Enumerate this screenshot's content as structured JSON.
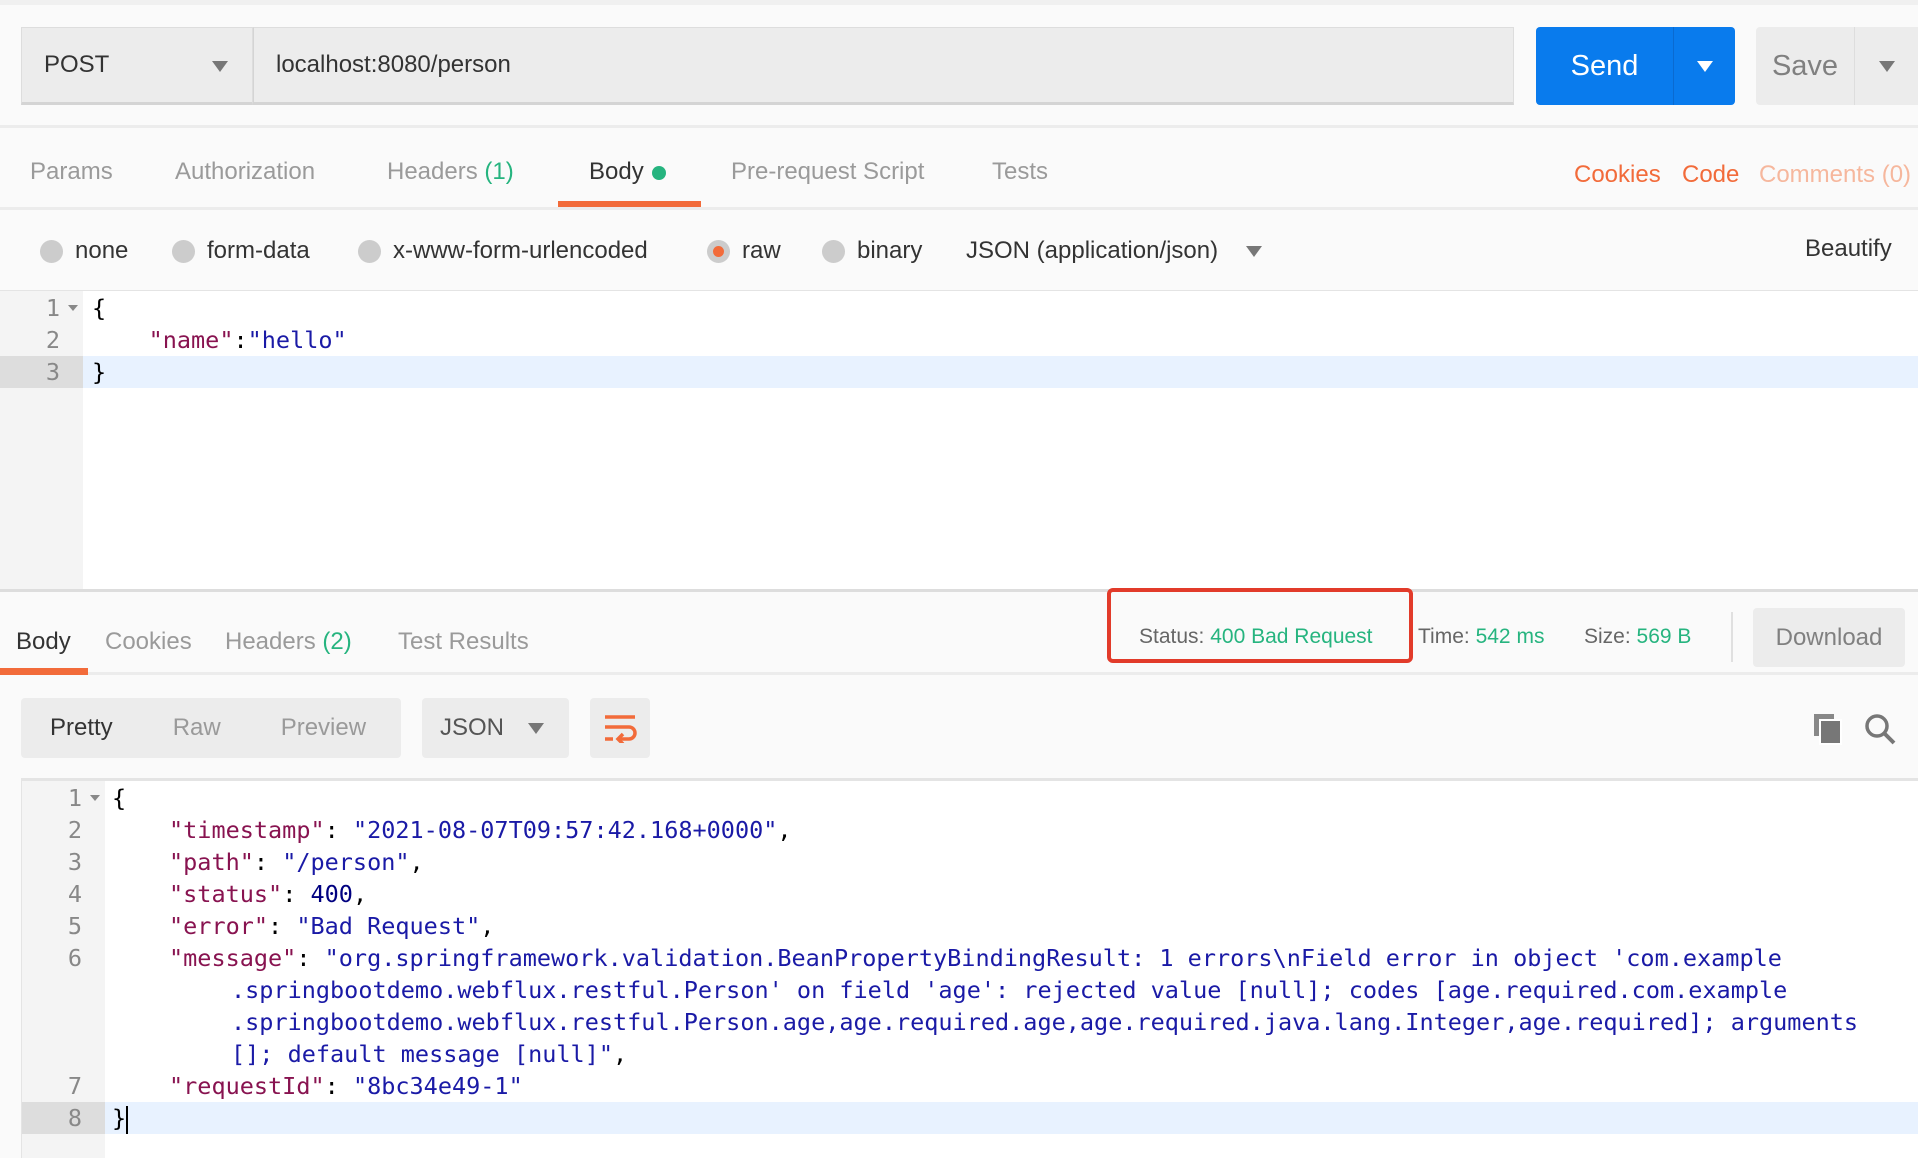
{
  "request": {
    "method": "POST",
    "url": "localhost:8080/person",
    "send_label": "Send",
    "save_label": "Save"
  },
  "tabs": [
    {
      "label": "Params"
    },
    {
      "label": "Authorization"
    },
    {
      "label": "Headers",
      "count": "(1)"
    },
    {
      "label": "Body"
    },
    {
      "label": "Pre-request Script"
    },
    {
      "label": "Tests"
    }
  ],
  "right_links": {
    "cookies": "Cookies",
    "code": "Code",
    "comments": "Comments (0)"
  },
  "body_types": [
    "none",
    "form-data",
    "x-www-form-urlencoded",
    "raw",
    "binary"
  ],
  "selected_body_type": "raw",
  "content_type": "JSON (application/json)",
  "beautify": "Beautify",
  "request_body": {
    "line_numbers": [
      "1",
      "2",
      "3"
    ],
    "lines": [
      "{",
      "    \"name\":\"hello\"",
      "}"
    ]
  },
  "response": {
    "tabs": [
      {
        "label": "Body"
      },
      {
        "label": "Cookies"
      },
      {
        "label": "Headers",
        "count": "(2)"
      },
      {
        "label": "Test Results"
      }
    ],
    "status_label": "Status:",
    "status": "400 Bad Request",
    "time_label": "Time:",
    "time": "542 ms",
    "size_label": "Size:",
    "size": "569 B",
    "download": "Download",
    "views": [
      "Pretty",
      "Raw",
      "Preview"
    ],
    "format": "JSON",
    "line_numbers": [
      "1",
      "2",
      "3",
      "4",
      "5",
      "6",
      "7",
      "8"
    ],
    "json": {
      "timestamp_key": "\"timestamp\"",
      "timestamp": "\"2021-08-07T09:57:42.168+0000\"",
      "path_key": "\"path\"",
      "path": "\"/person\"",
      "status_key": "\"status\"",
      "status": "400",
      "error_key": "\"error\"",
      "error": "\"Bad Request\"",
      "message_key": "\"message\"",
      "message_lines": [
        "\"org.springframework.validation.BeanPropertyBindingResult: 1 errors\\nField error in object 'com.example",
        ".springbootdemo.webflux.restful.Person' on field 'age': rejected value [null]; codes [age.required.com.example",
        ".springbootdemo.webflux.restful.Person.age,age.required.age,age.required.java.lang.Integer,age.required]; arguments",
        "[]; default message [null]\""
      ],
      "requestId_key": "\"requestId\"",
      "requestId": "\"8bc34e49-1\""
    }
  },
  "colors": {
    "accent": "#f26b3a",
    "send": "#097bed",
    "success": "#26b47f",
    "highlight_box": "#e23b2a"
  }
}
